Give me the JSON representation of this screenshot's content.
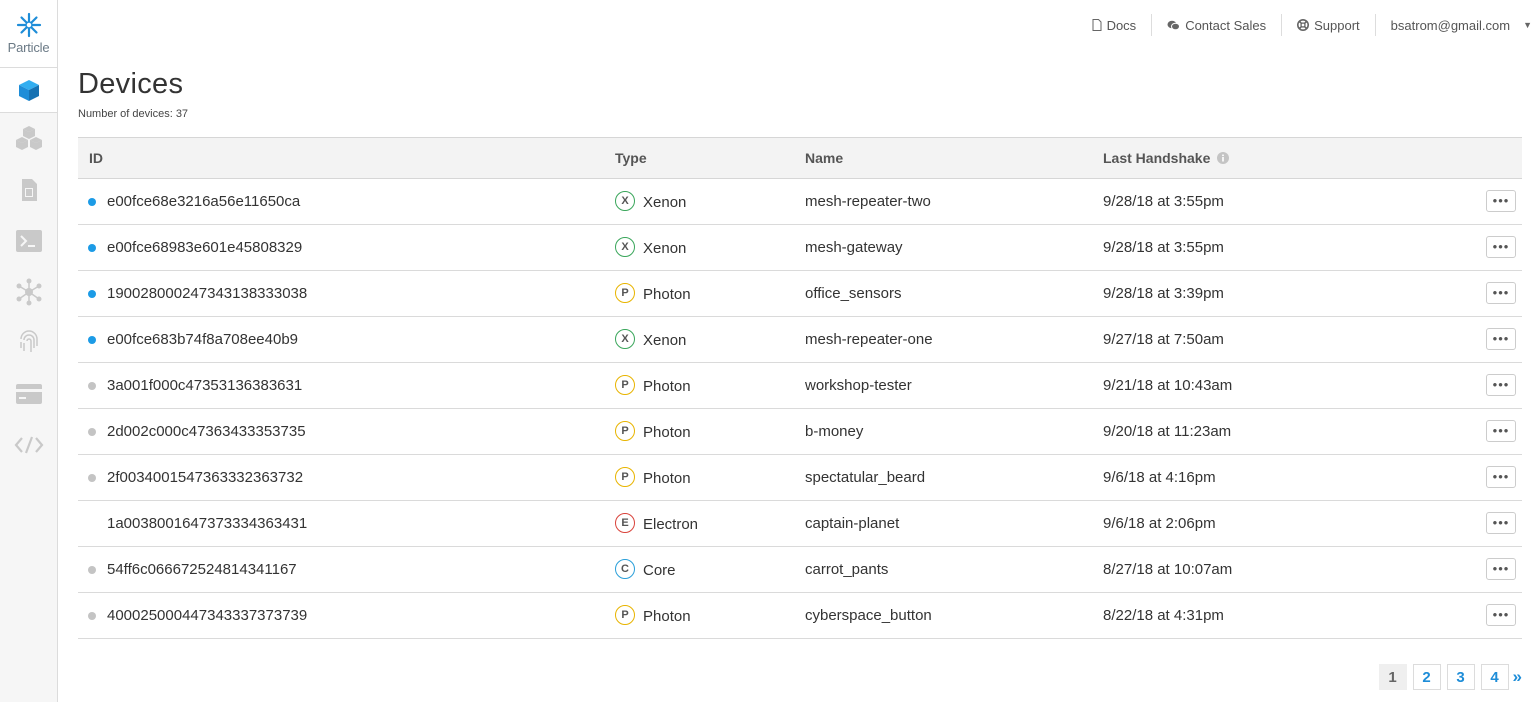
{
  "brand": {
    "name": "Particle"
  },
  "sidebar": {
    "items": [
      {
        "name": "devices",
        "icon": "cube-icon",
        "active": true
      },
      {
        "name": "products",
        "icon": "cubes-icon"
      },
      {
        "name": "sim-cards",
        "icon": "sim-card-icon"
      },
      {
        "name": "console",
        "icon": "terminal-icon"
      },
      {
        "name": "integrations",
        "icon": "network-icon"
      },
      {
        "name": "authentication",
        "icon": "fingerprint-icon"
      },
      {
        "name": "billing",
        "icon": "credit-card-icon"
      },
      {
        "name": "developer",
        "icon": "code-icon"
      }
    ]
  },
  "topbar": {
    "docs": "Docs",
    "contact_sales": "Contact Sales",
    "support": "Support",
    "user": "bsatrom@gmail.com"
  },
  "header": {
    "title": "Devices",
    "count_text": "Number of devices: 37"
  },
  "table": {
    "columns": {
      "id": "ID",
      "type": "Type",
      "name": "Name",
      "last_handshake": "Last Handshake"
    },
    "more_label": "•••",
    "rows": [
      {
        "status": "online",
        "id": "e00fce68e3216a56e11650ca",
        "type_letter": "X",
        "type": "Xenon",
        "name": "mesh-repeater-two",
        "last_handshake": "9/28/18 at 3:55pm"
      },
      {
        "status": "online",
        "id": "e00fce68983e601e45808329",
        "type_letter": "X",
        "type": "Xenon",
        "name": "mesh-gateway",
        "last_handshake": "9/28/18 at 3:55pm"
      },
      {
        "status": "online",
        "id": "190028000247343138333038",
        "type_letter": "P",
        "type": "Photon",
        "name": "office_sensors",
        "last_handshake": "9/28/18 at 3:39pm"
      },
      {
        "status": "online",
        "id": "e00fce683b74f8a708ee40b9",
        "type_letter": "X",
        "type": "Xenon",
        "name": "mesh-repeater-one",
        "last_handshake": "9/27/18 at 7:50am"
      },
      {
        "status": "offline",
        "id": "3a001f000c47353136383631",
        "type_letter": "P",
        "type": "Photon",
        "name": "workshop-tester",
        "last_handshake": "9/21/18 at 10:43am"
      },
      {
        "status": "offline",
        "id": "2d002c000c47363433353735",
        "type_letter": "P",
        "type": "Photon",
        "name": "b-money",
        "last_handshake": "9/20/18 at 11:23am"
      },
      {
        "status": "offline",
        "id": "2f0034001547363332363732",
        "type_letter": "P",
        "type": "Photon",
        "name": "spectatular_beard",
        "last_handshake": "9/6/18 at 4:16pm"
      },
      {
        "status": "none",
        "id": "1a0038001647373334363431",
        "type_letter": "E",
        "type": "Electron",
        "name": "captain-planet",
        "last_handshake": "9/6/18 at 2:06pm"
      },
      {
        "status": "offline",
        "id": "54ff6c066672524814341167",
        "type_letter": "C",
        "type": "Core",
        "name": "carrot_pants",
        "last_handshake": "8/27/18 at 10:07am"
      },
      {
        "status": "offline",
        "id": "400025000447343337373739",
        "type_letter": "P",
        "type": "Photon",
        "name": "cyberspace_button",
        "last_handshake": "8/22/18 at 4:31pm"
      }
    ]
  },
  "pagination": {
    "pages": [
      "1",
      "2",
      "3",
      "4"
    ],
    "current": "1",
    "next": "»"
  },
  "colors": {
    "accent": "#1e8dd8",
    "online": "#1c9be6",
    "offline": "#c4c4c4",
    "Xenon": "#3aa65b",
    "Photon": "#e8b400",
    "Electron": "#d9433b",
    "Core": "#2a9fd9"
  }
}
